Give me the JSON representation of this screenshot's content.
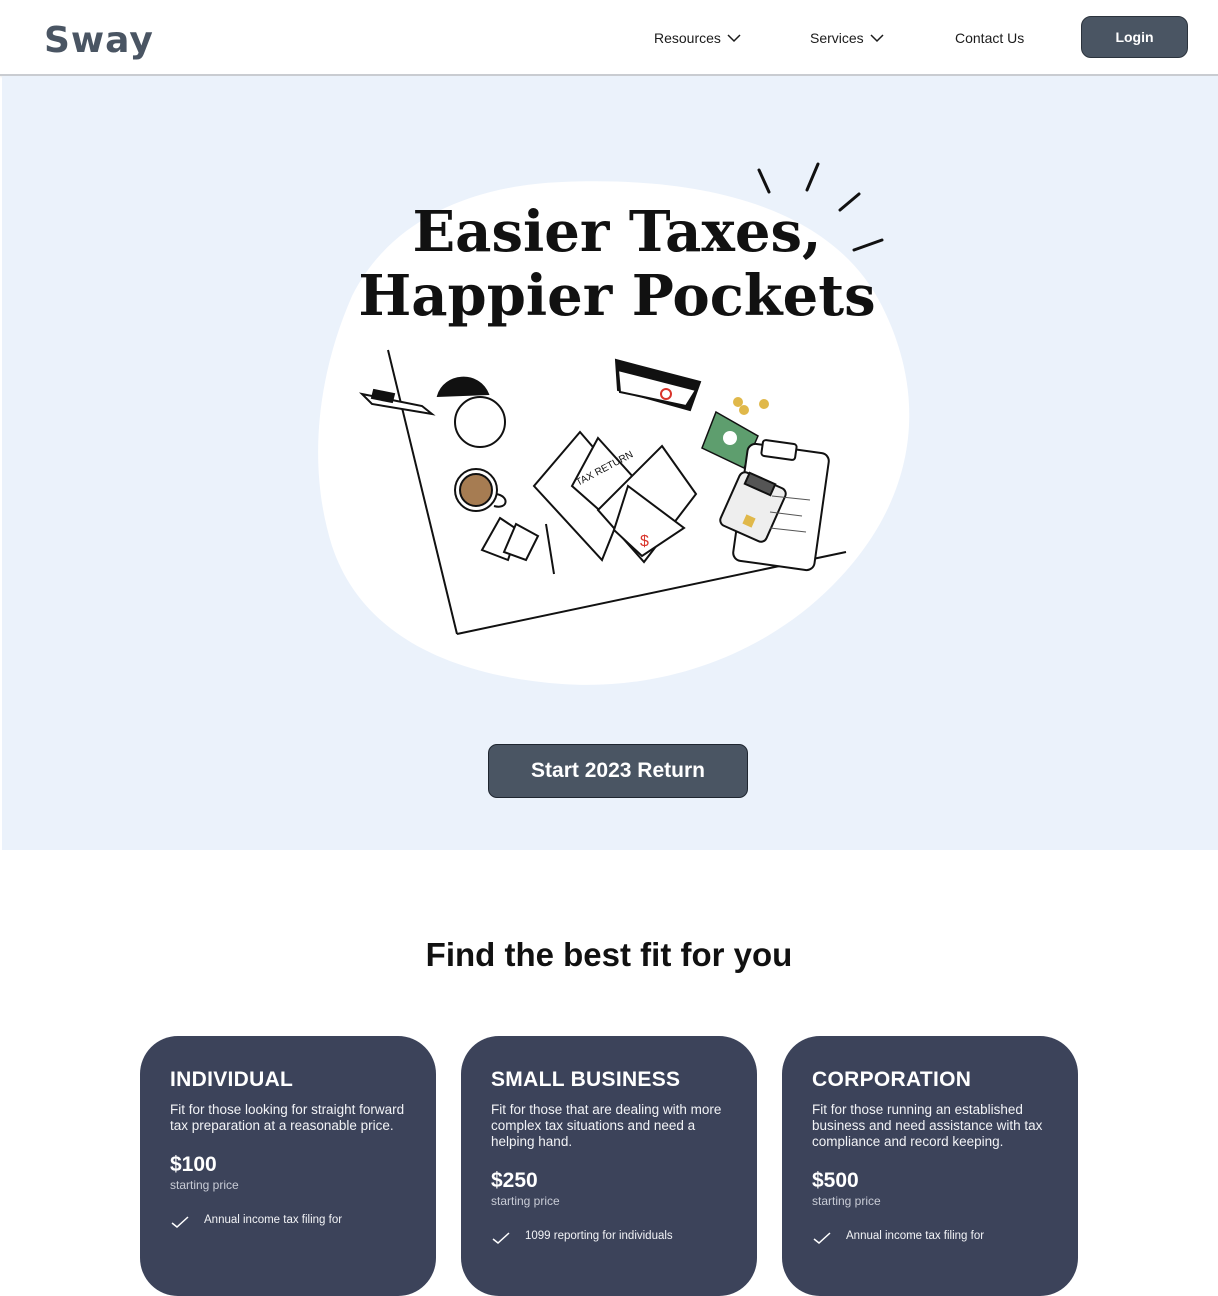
{
  "header": {
    "logo_text": "Sway",
    "nav": {
      "resources": "Resources",
      "services": "Services",
      "contact": "Contact Us"
    },
    "login_label": "Login"
  },
  "hero": {
    "title_line1": "Easier Taxes,",
    "title_line2": "Happier Pockets",
    "illustration_text": "TAX RETURN",
    "cta_label": "Start 2023 Return"
  },
  "plans": {
    "title": "Find the best fit for you",
    "cards": [
      {
        "name": "INDIVIDUAL",
        "description": "Fit for those looking for straight forward tax preparation at a reasonable price.",
        "price": "$100",
        "price_note": "starting price",
        "first_feature": "Annual income tax filing for"
      },
      {
        "name": "SMALL BUSINESS",
        "description": "Fit for those that are dealing with more complex tax situations and need a helping hand.",
        "price": "$250",
        "price_note": "starting price",
        "first_feature": "1099 reporting for individuals"
      },
      {
        "name": "CORPORATION",
        "description": "Fit for those running an established business and need assistance with tax compliance and record keeping.",
        "price": "$500",
        "price_note": "starting price",
        "first_feature": "Annual income tax filing for"
      }
    ]
  },
  "colors": {
    "accent_dark": "#4a5563",
    "card_bg": "#3c435a",
    "hero_bg": "#ebf2fb",
    "money_green": "#5e9e6e",
    "coin_gold": "#e0b84a",
    "ink_red": "#d9342b"
  },
  "icons": [
    "chevron-down-icon",
    "check-icon"
  ]
}
